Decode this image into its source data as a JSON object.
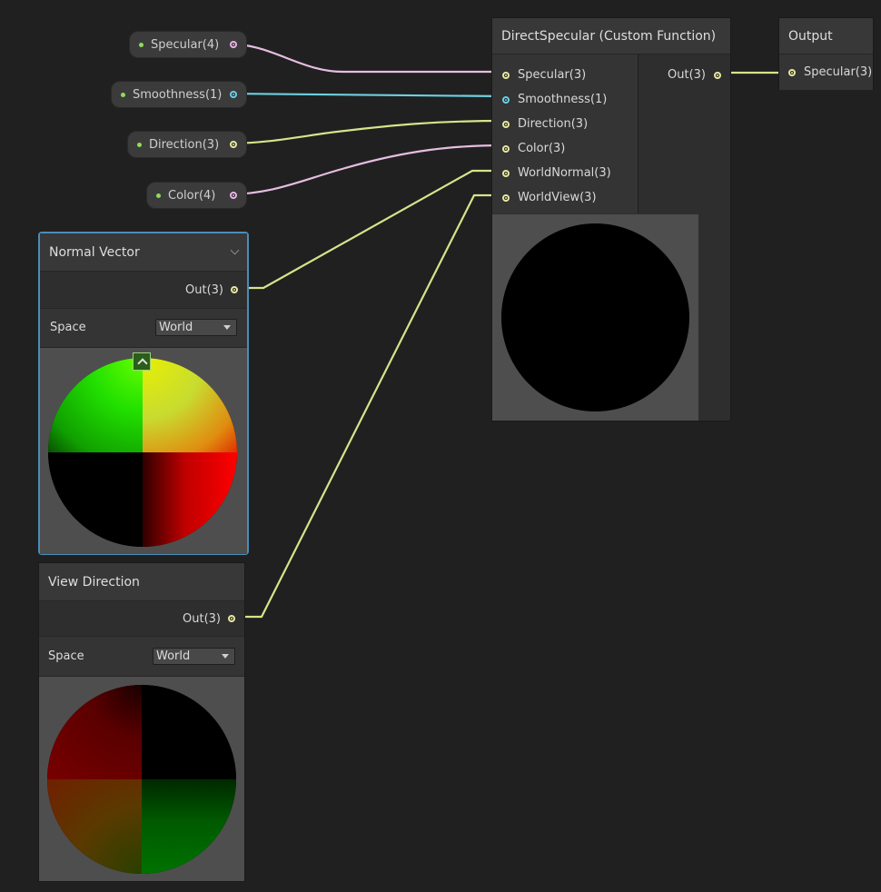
{
  "property_nodes": [
    {
      "label": "Specular(4)",
      "port_color": "pink"
    },
    {
      "label": "Smoothness(1)",
      "port_color": "cyan"
    },
    {
      "label": "Direction(3)",
      "port_color": "yellow"
    },
    {
      "label": "Color(4)",
      "port_color": "pink"
    }
  ],
  "custom_function": {
    "title": "DirectSpecular (Custom Function)",
    "inputs": [
      "Specular(3)",
      "Smoothness(1)",
      "Direction(3)",
      "Color(3)",
      "WorldNormal(3)",
      "WorldView(3)"
    ],
    "output": "Out(3)"
  },
  "output_node": {
    "title": "Output",
    "input": "Specular(3)"
  },
  "normal_vector": {
    "title": "Normal Vector",
    "output": "Out(3)",
    "space_label": "Space",
    "space_value": "World"
  },
  "view_direction": {
    "title": "View Direction",
    "output": "Out(3)",
    "space_label": "Space",
    "space_value": "World"
  },
  "colors": {
    "wire_yellow": "#d7e38a",
    "wire_pink": "#e6bde0",
    "wire_cyan": "#6fcfe0",
    "selection": "#4a8db8"
  }
}
